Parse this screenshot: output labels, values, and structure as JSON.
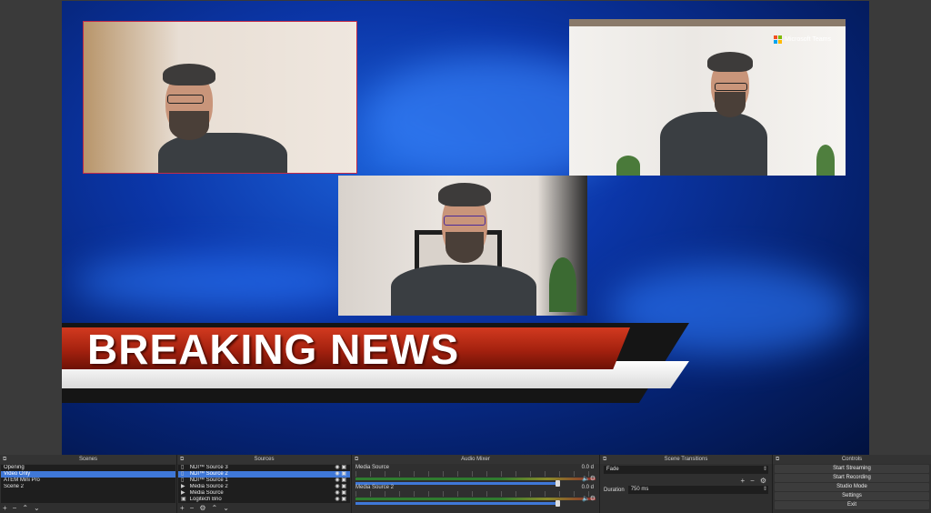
{
  "preview": {
    "teams_logo_text": "Microsoft Teams",
    "banner_title": "BREAKING NEWS",
    "colors": {
      "banner_red": "#b8260f",
      "selection_border": "#c12b48"
    }
  },
  "scenes": {
    "title": "Scenes",
    "items": [
      "Opening",
      "Video Only",
      "ATEM Mini Pro",
      "Scene 2"
    ],
    "selected_index": 1,
    "footer_icons": [
      "plus-icon",
      "minus-icon",
      "up-icon",
      "down-icon"
    ]
  },
  "sources": {
    "title": "Sources",
    "items": [
      {
        "label": "NDI™ Source 3",
        "icon": "ndi-icon"
      },
      {
        "label": "NDI™ Source 2",
        "icon": "ndi-icon"
      },
      {
        "label": "NDI™ Source 1",
        "icon": "ndi-icon"
      },
      {
        "label": "Media Source 2",
        "icon": "play-icon"
      },
      {
        "label": "Media Source",
        "icon": "play-icon"
      },
      {
        "label": "Logitech Brio",
        "icon": "camera-icon"
      }
    ],
    "selected_index": 1
  },
  "mixer": {
    "title": "Audio Mixer",
    "tracks": [
      {
        "name": "Media Source",
        "db": "0.0 d"
      },
      {
        "name": "Media Source 2",
        "db": "0.0 d"
      }
    ]
  },
  "transitions": {
    "title": "Scene Transitions",
    "selected": "Fade",
    "duration_label": "Duration",
    "duration_value": "750 ms"
  },
  "controls": {
    "title": "Controls",
    "buttons": [
      "Start Streaming",
      "Start Recording",
      "Studio Mode",
      "Settings",
      "Exit"
    ]
  }
}
